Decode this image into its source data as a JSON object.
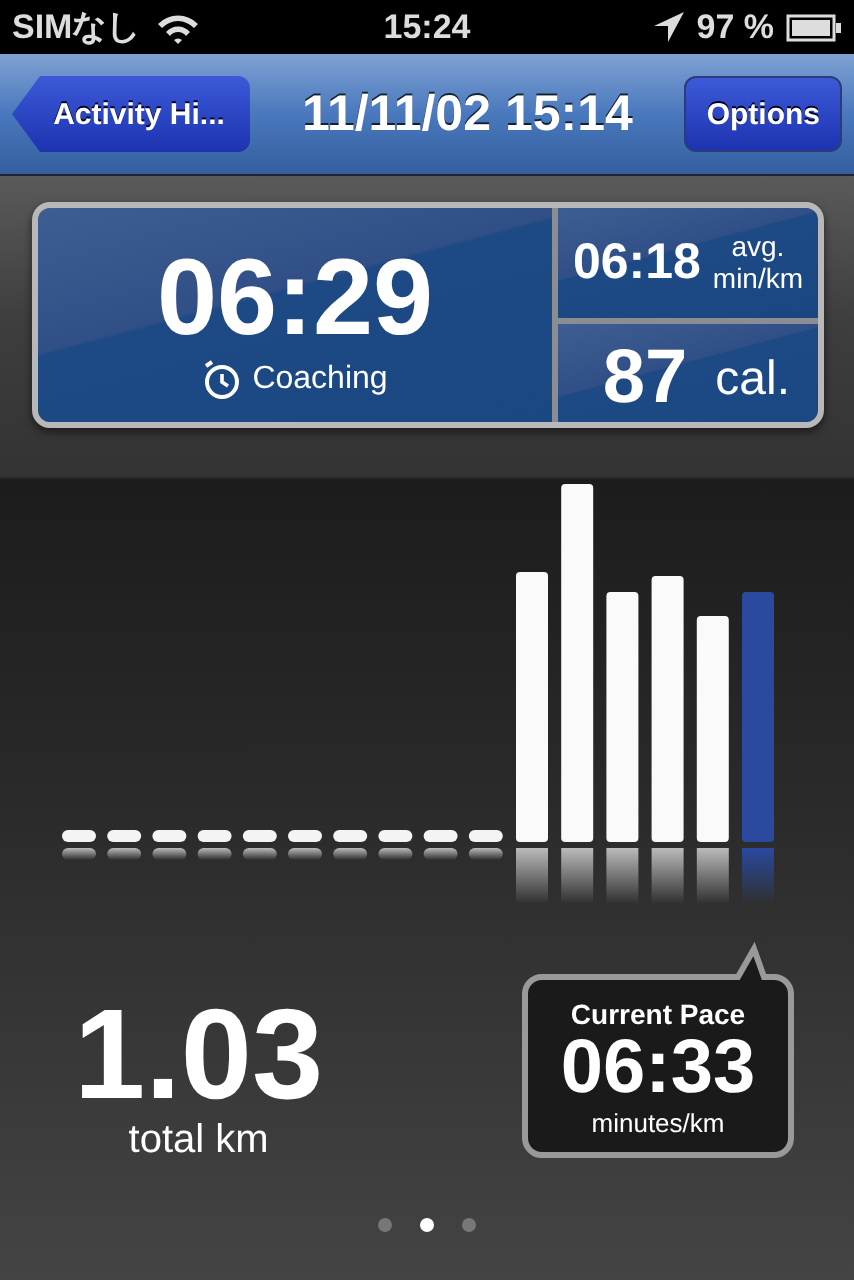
{
  "status_bar": {
    "carrier": "SIMなし",
    "time": "15:24",
    "battery": "97 %"
  },
  "nav_bar": {
    "back_button": "Activity Hi...",
    "title": "11/11/02 15:14",
    "options_button": "Options"
  },
  "stats": {
    "duration": "06:29",
    "mode": "Coaching",
    "avg_pace": "06:18",
    "avg_label": "avg.",
    "avg_unit": "min/km",
    "calories": "87",
    "calories_unit": "cal."
  },
  "distance": {
    "value": "1.03",
    "unit": "total km"
  },
  "current_pace": {
    "title": "Current Pace",
    "value": "06:33",
    "unit": "minutes/km"
  },
  "page_dots": [
    {
      "selected": false
    },
    {
      "selected": true
    },
    {
      "selected": false
    }
  ]
}
